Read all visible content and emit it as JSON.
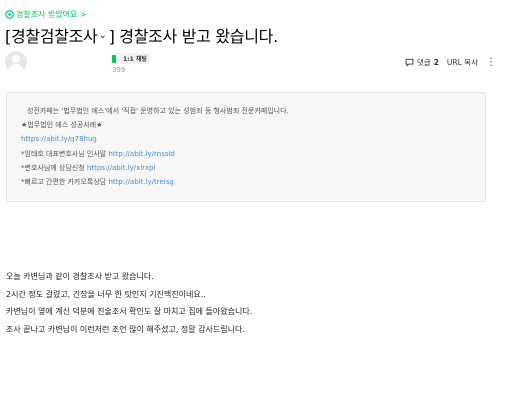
{
  "breadcrumb": {
    "label": "경찰조사 받았어요 >"
  },
  "post": {
    "title": "[경찰검찰조사",
    "title_rest": "] 경찰조사 받고 왔습니다.",
    "chat_label": "1:1 채팅",
    "date": "399",
    "comments_label": "댓글",
    "comments_count": "2",
    "url_copy": "URL 복사",
    "more": "⋮"
  },
  "info": {
    "line1": "성전카페는 '법무법인 에스'에서 '직접' 운영하고 있는 성범죄 등 형사범죄 전문카페입니다.",
    "line2": "★법무법인 에스 성공사례★",
    "line3_link": "https://abit.ly/q78hug",
    "line4_text": "*임태호 대표변호사님 인사말",
    "line4_link": "http://abit.ly/rnssld",
    "line5_text": "*변호사님께 상담신청",
    "line5_link": "https://abit.ly/xlrxpi",
    "line6_text": "*빠르고 간편한 카카오톡상담",
    "line6_link": "http://abit.ly/treisg"
  },
  "body": {
    "p1": "오늘 카변님과 같이 경찰조사 받고 왔습니다.",
    "p2": "2시간 정도 걸렸고, 긴장을 너무 한 탓인지 기진맥진이네요..",
    "p3": "카변님이 옆에 계신 덕분에 진술조서 확인도 잘 마치고 집에 돌아왔습니다.",
    "p4": "조사 끝나고 카변님이 이런저런 조언 많이 해주셨고, 정말 감사드립니다."
  },
  "colors": {
    "accent": "#03c75a",
    "link": "#4b8ccf",
    "box_bg": "#f7f7f7"
  }
}
